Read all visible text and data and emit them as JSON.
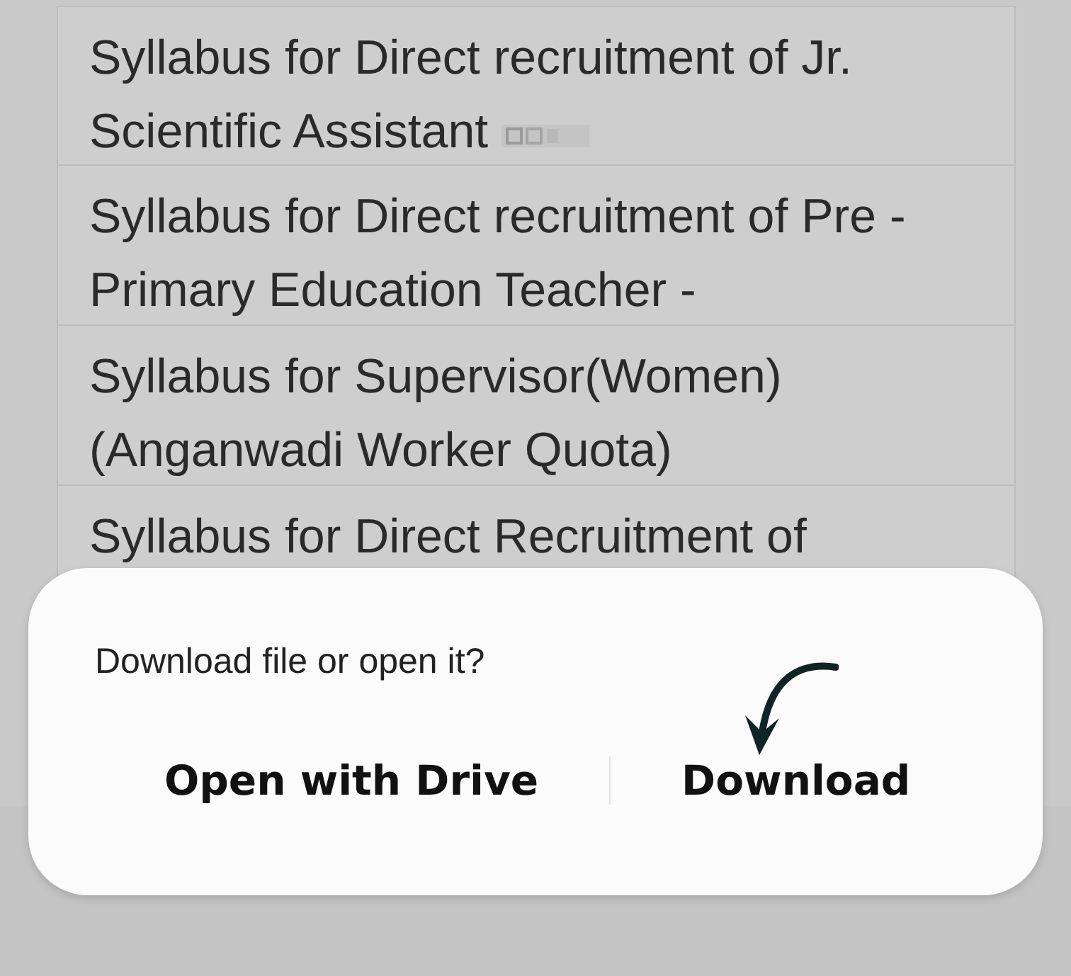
{
  "list": {
    "rows": [
      {
        "text": "Syllabus for Direct recruitment of Jr. Scientific Assistant",
        "badge": true
      },
      {
        "text": "Syllabus for Direct recruitment of Pre - Primary Education Teacher -",
        "badge": false
      },
      {
        "text": "Syllabus for Supervisor(Women) (Anganwadi Worker Quota)",
        "badge": false
      },
      {
        "text": "Syllabus for Direct Recruitment of",
        "badge": false
      }
    ]
  },
  "dialog": {
    "question": "Download file or open it?",
    "buttons": [
      {
        "label": "Open with Drive",
        "pointed": false
      },
      {
        "label": "Download",
        "pointed": true
      }
    ]
  }
}
